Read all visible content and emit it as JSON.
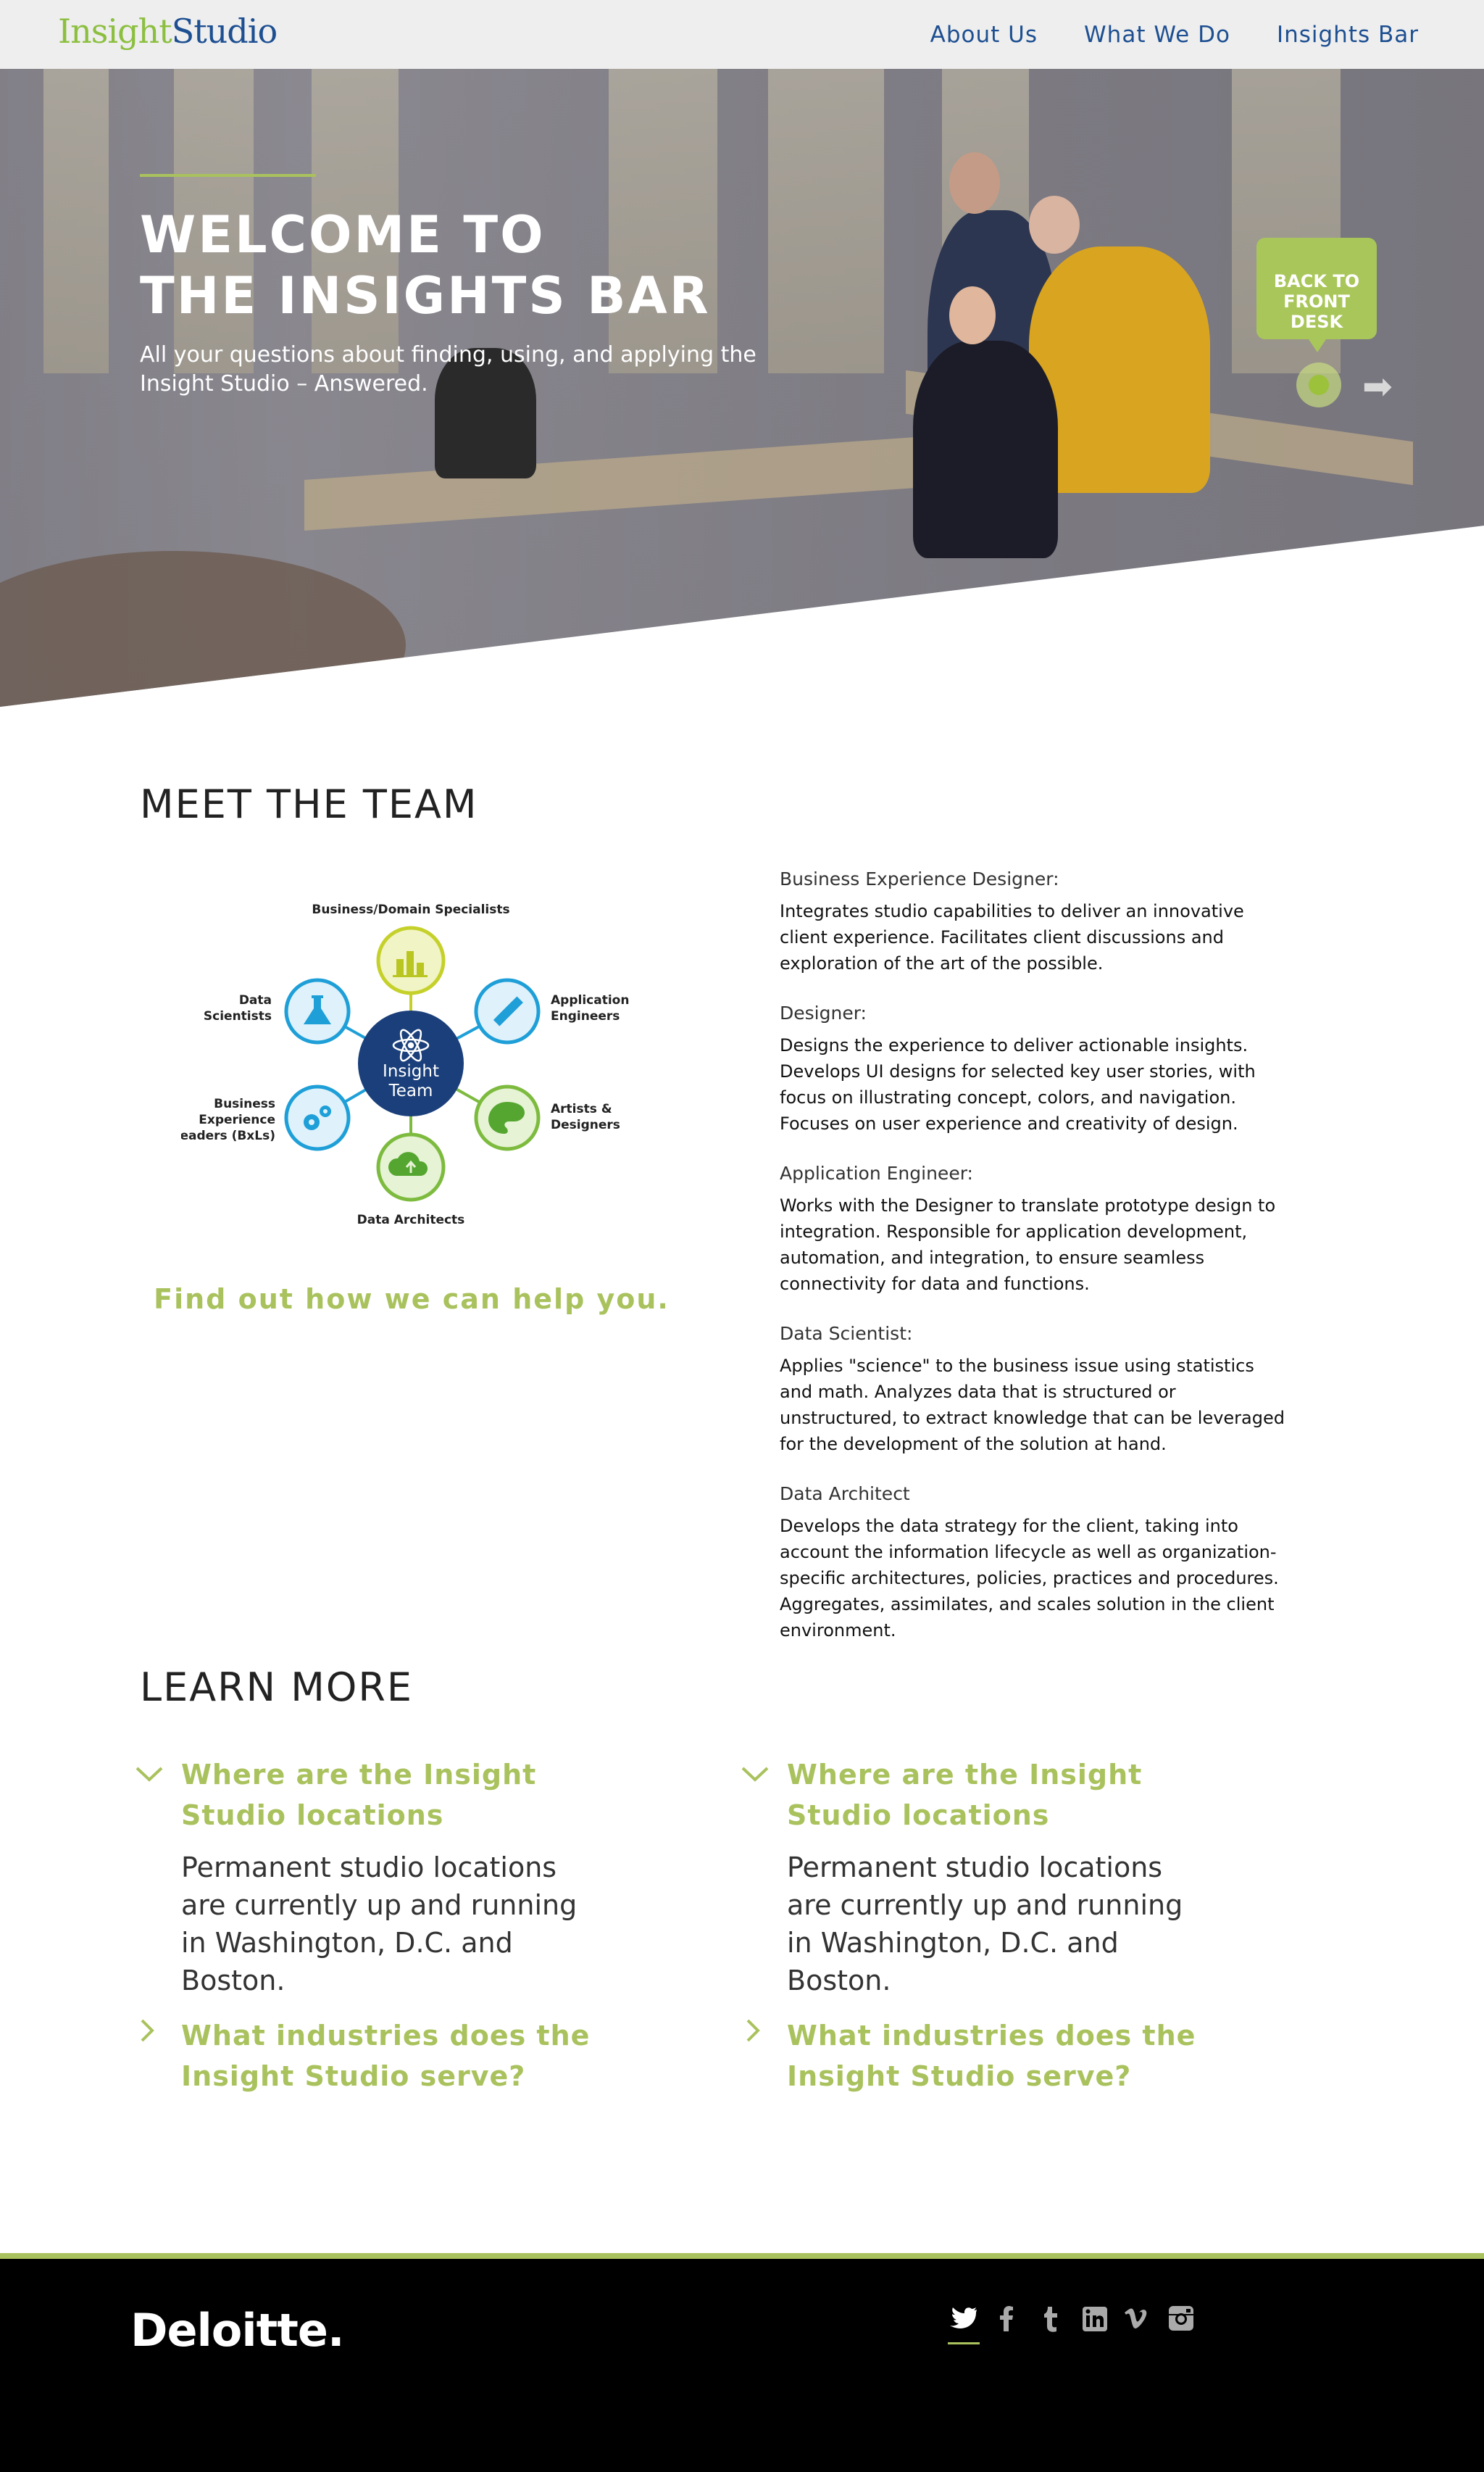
{
  "nav": {
    "logo_part1": "Insight",
    "logo_part2": "Studio",
    "links": [
      "About Us",
      "What We Do",
      "Insights Bar"
    ]
  },
  "hero": {
    "title_line1": "WELCOME TO",
    "title_line2": "THE INSIGHTS BAR",
    "subtitle": "All your questions about finding, using, and applying the Insight Studio – Answered.",
    "back_button_line1": "BACK TO",
    "back_button_line2": "FRONT DESK"
  },
  "team": {
    "heading": "MEET THE TEAM",
    "diagram": {
      "center_line1": "Insight",
      "center_line2": "Team",
      "nodes": {
        "top": "Business/Domain Specialists",
        "upper_left_1": "Data",
        "upper_left_2": "Scientists",
        "upper_right_1": "Application",
        "upper_right_2": "Engineers",
        "lower_left_1": "Business",
        "lower_left_2": "Experience",
        "lower_left_3": "Leaders (BxLs)",
        "lower_right_1": "Artists &",
        "lower_right_2": "Designers",
        "bottom": "Data Architects"
      }
    },
    "cta": "Find out how we can help you.",
    "roles": [
      {
        "title": "Business Experience Designer:",
        "desc": "Integrates studio capabilities to deliver an innovative client experience. Facilitates client discussions and exploration of the art of the possible."
      },
      {
        "title": "Designer:",
        "desc": "Designs the experience to deliver actionable insights. Develops UI designs for selected key user stories, with focus on illustrating concept, colors, and navigation. Focuses on user experience and creativity of design."
      },
      {
        "title": "Application Engineer:",
        "desc": "Works with the Designer to translate prototype design to integration. Responsible for application development, automation, and integration, to ensure seamless connectivity for data and functions."
      },
      {
        "title": "Data Scientist:",
        "desc": "Applies \"science\" to the business issue using statistics and math. Analyzes data that is structured or unstructured, to extract knowledge that can be leveraged for the development of the solution at hand."
      },
      {
        "title": "Data Architect",
        "desc": "Develops the data strategy for the client, taking into account the information lifecycle as well as organization-specific architectures, policies, practices and procedures. Aggregates, assimilates, and scales solution in the client environment."
      }
    ]
  },
  "learn": {
    "heading": "LEARN MORE",
    "col1": {
      "q1": "Where are the Insight Studio locations",
      "a1": "Permanent studio locations are currently up and running in Washington, D.C. and Boston.",
      "q2": "What industries does the Insight Studio serve?"
    },
    "col2": {
      "q1": "Where are the Insight Studio locations",
      "a1": "Permanent studio locations are currently up and running in Washington, D.C. and Boston.",
      "q2": "What industries does the Insight Studio serve?"
    }
  },
  "footer": {
    "brand": "Deloitte.",
    "social_icons": [
      "twitter-icon",
      "facebook-icon",
      "tumblr-icon",
      "linkedin-icon",
      "vimeo-icon",
      "instagram-icon"
    ]
  },
  "colors": {
    "accent_green": "#a9c25d",
    "brand_blue": "#1d4f91",
    "diagram_blue": "#1e9fd8",
    "diagram_green": "#7dbb3f",
    "diagram_lime": "#c5d12a"
  }
}
